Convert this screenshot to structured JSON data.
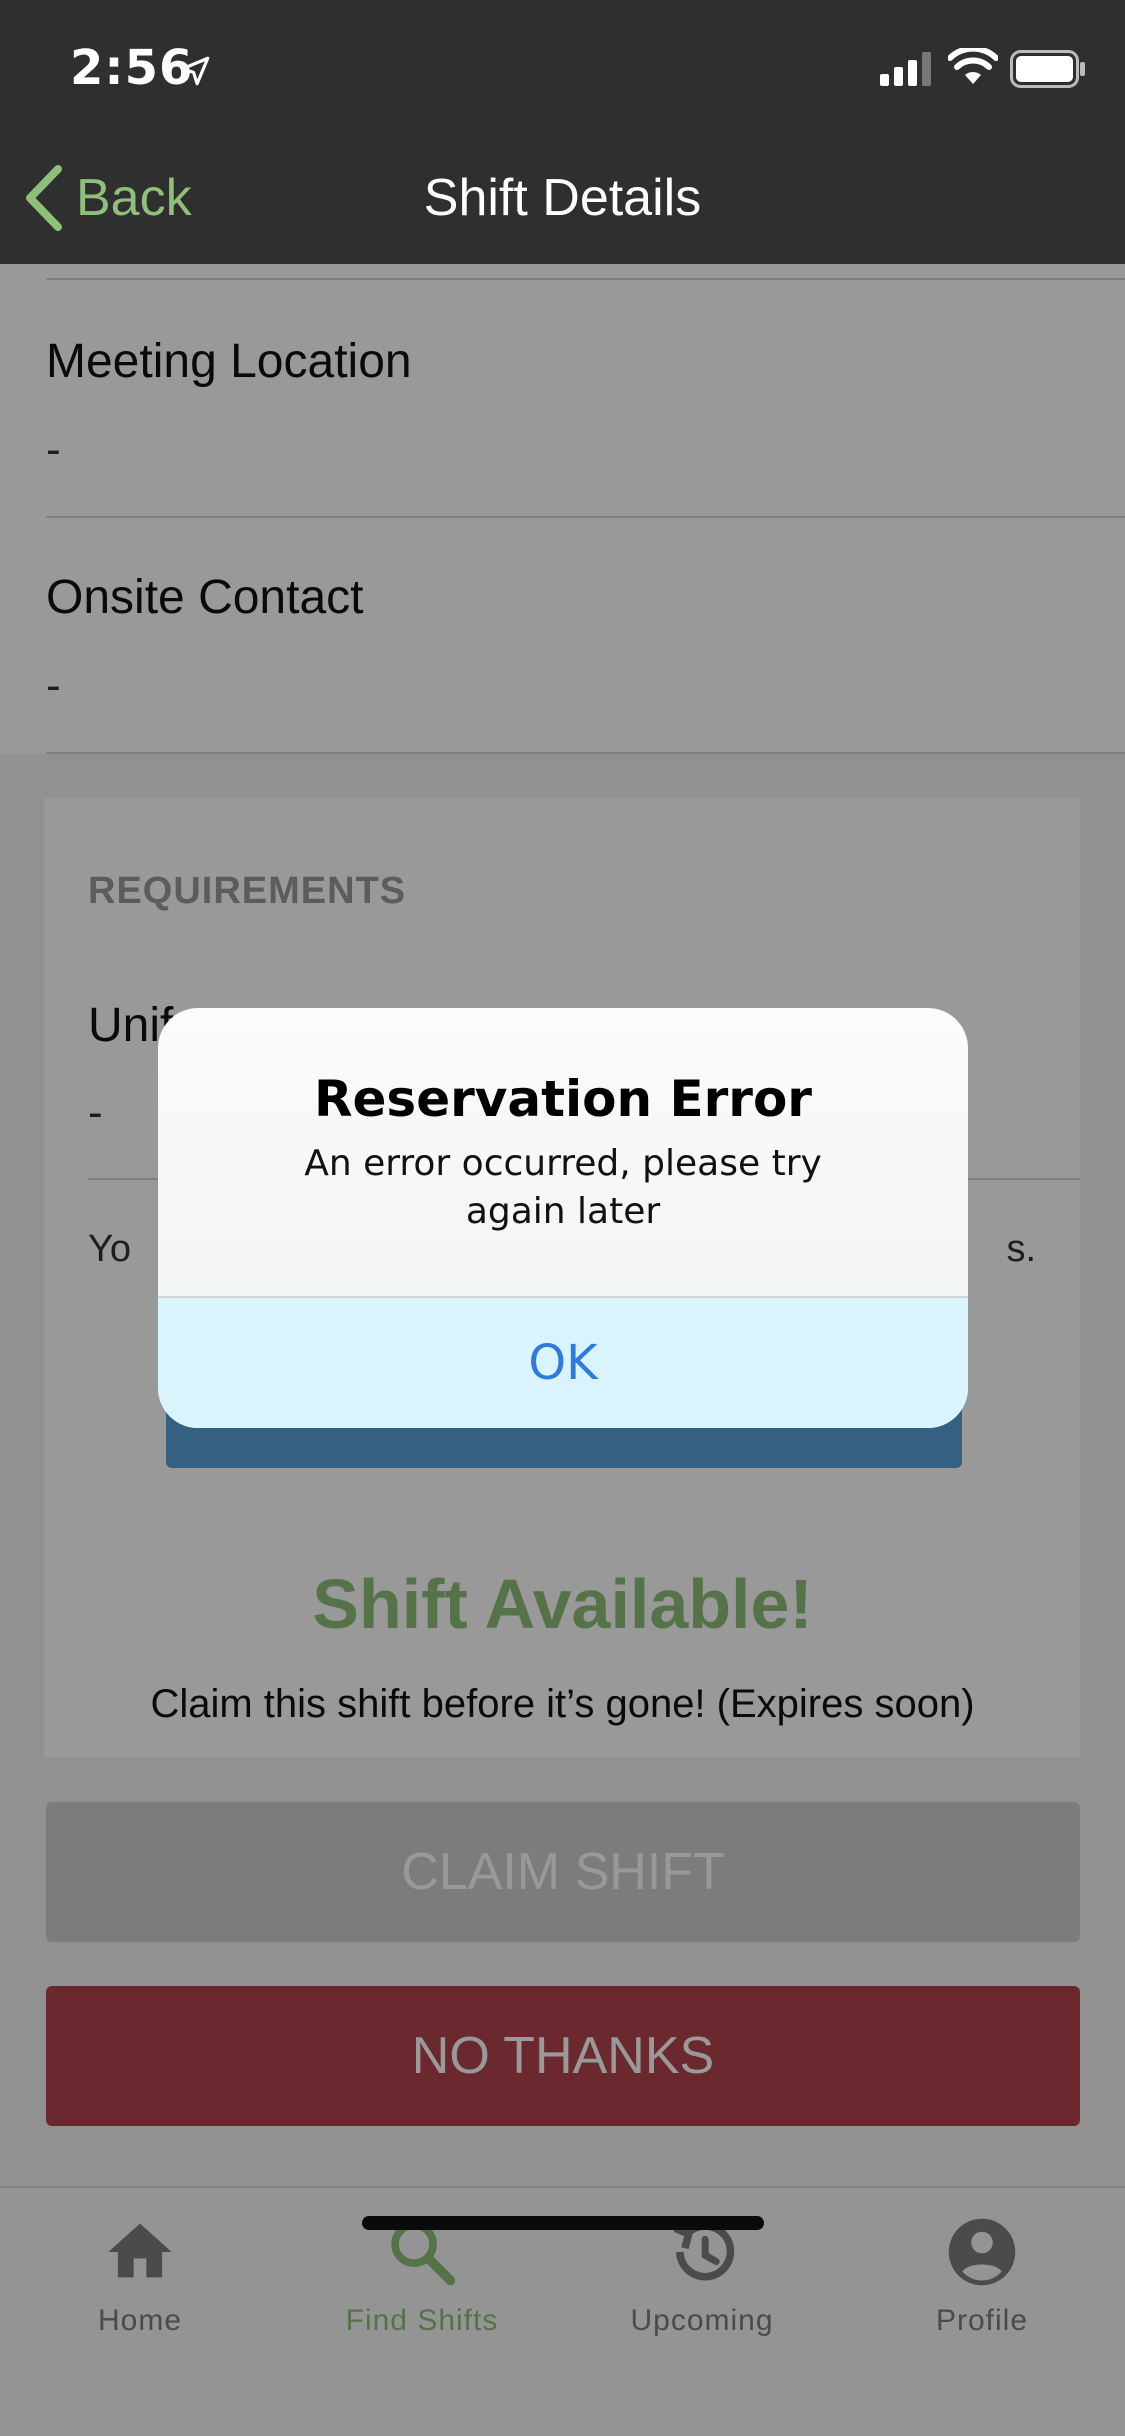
{
  "status_bar": {
    "time": "2:56"
  },
  "nav": {
    "back_label": "Back",
    "title": "Shift Details"
  },
  "fields": [
    {
      "label": "Meeting Location",
      "value": "-"
    },
    {
      "label": "Onsite Contact",
      "value": "-"
    }
  ],
  "requirements": {
    "title": "REQUIREMENTS",
    "item_label": "Unif",
    "item_value": "-",
    "note_left": "Yo",
    "note_right": "s."
  },
  "availability": {
    "title": "Shift Available!",
    "subtitle": "Claim this shift before it’s gone! (Expires soon)",
    "claim_label": "CLAIM SHIFT",
    "decline_label": "NO THANKS"
  },
  "tabbar": {
    "items": [
      {
        "label": "Home",
        "icon": "home-icon",
        "active": false
      },
      {
        "label": "Find Shifts",
        "icon": "search-icon",
        "active": true
      },
      {
        "label": "Upcoming",
        "icon": "history-icon",
        "active": false
      },
      {
        "label": "Profile",
        "icon": "profile-icon",
        "active": false
      }
    ]
  },
  "alert": {
    "title": "Reservation Error",
    "message": "An error occurred, please try again later",
    "ok_label": "OK"
  },
  "colors": {
    "accent_green": "#8fbf7a",
    "nav_bar": "#2f2f2f",
    "decline_red": "#b3444e",
    "alert_button_text": "#2f7bdc"
  }
}
